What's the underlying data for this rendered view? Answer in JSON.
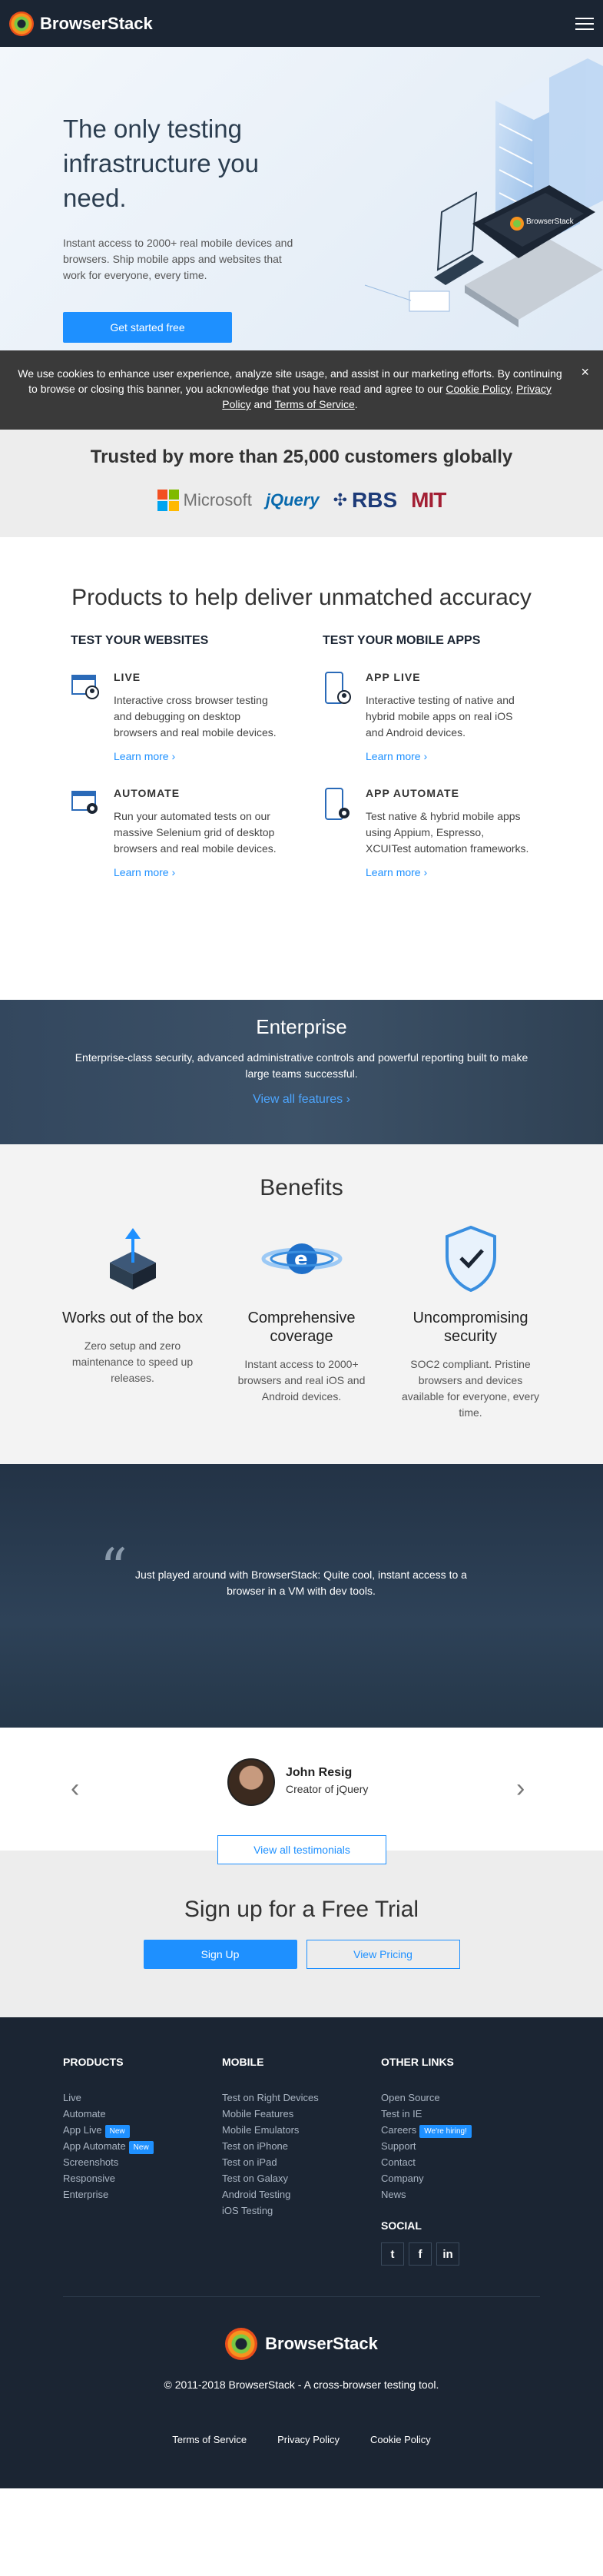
{
  "header": {
    "brand": "BrowserStack"
  },
  "hero": {
    "title": "The only testing infrastructure you need.",
    "subtitle": "Instant access to 2000+ real mobile devices and browsers. Ship mobile apps and websites that work for everyone, every time.",
    "cta": "Get started free"
  },
  "cookie": {
    "text": "We use cookies to enhance user experience, analyze site usage, and assist in our marketing efforts. By continuing to browse or closing this banner, you acknowledge that you have read and agree to our",
    "cookie_policy": "Cookie Policy",
    "comma": ",",
    "privacy_policy": "Privacy Policy",
    "and": "and",
    "terms": "Terms of Service",
    "period": ".",
    "close": "×"
  },
  "trusted": {
    "title": "Trusted by more than 25,000 customers globally",
    "logos": {
      "microsoft": "Microsoft",
      "jquery": "jQuery",
      "rbs": "RBS",
      "mit": "MIT"
    }
  },
  "products": {
    "title": "Products to help deliver unmatched accuracy",
    "websites": {
      "heading": "TEST YOUR WEBSITES",
      "items": [
        {
          "name": "LIVE",
          "desc": "Interactive cross browser testing and debugging on desktop browsers and real mobile devices.",
          "link": "Learn more ›"
        },
        {
          "name": "AUTOMATE",
          "desc": "Run your automated tests on our massive Selenium grid of desktop browsers and real mobile devices.",
          "link": "Learn more ›"
        }
      ]
    },
    "mobile": {
      "heading": "TEST YOUR MOBILE APPS",
      "items": [
        {
          "name": "APP LIVE",
          "desc": "Interactive testing of native and hybrid mobile apps on real iOS and Android devices.",
          "link": "Learn more ›"
        },
        {
          "name": "APP AUTOMATE",
          "desc": "Test native & hybrid mobile apps using Appium, Espresso, XCUITest automation frameworks.",
          "link": "Learn more ›"
        }
      ]
    }
  },
  "enterprise": {
    "title": "Enterprise",
    "desc": "Enterprise-class security, advanced administrative controls and powerful reporting built to make large teams successful.",
    "link": "View all features ›"
  },
  "benefits": {
    "title": "Benefits",
    "items": [
      {
        "title": "Works out of the box",
        "desc": "Zero setup and zero maintenance to speed up releases."
      },
      {
        "title": "Comprehensive coverage",
        "desc": "Instant access to 2000+ browsers and real iOS and Android devices."
      },
      {
        "title": "Uncompromising security",
        "desc": "SOC2 compliant. Pristine browsers and devices available for everyone, every time."
      }
    ]
  },
  "testimonial": {
    "quote_mark": "“",
    "quote": "Just played around with BrowserStack: Quite cool, instant access to a browser in a VM with dev tools.",
    "author": "John Resig",
    "role": "Creator of jQuery",
    "prev": "‹",
    "next": "›",
    "view_all": "View all testimonials"
  },
  "signup": {
    "title": "Sign up for a Free Trial",
    "signup_btn": "Sign Up",
    "pricing_btn": "View Pricing"
  },
  "footer": {
    "products": {
      "heading": "PRODUCTS",
      "links": [
        "Live",
        "Automate",
        "App Live",
        "App Automate",
        "Screenshots",
        "Responsive",
        "Enterprise"
      ],
      "new_badge": "New"
    },
    "mobile": {
      "heading": "MOBILE",
      "links": [
        "Test on Right Devices",
        "Mobile Features",
        "Mobile Emulators",
        "Test on iPhone",
        "Test on iPad",
        "Test on Galaxy",
        "Android Testing",
        "iOS Testing"
      ]
    },
    "other": {
      "heading": "OTHER LINKS",
      "links": [
        "Open Source",
        "Test in IE",
        "Careers",
        "Support",
        "Contact",
        "Company",
        "News"
      ],
      "hiring_badge": "We're hiring!"
    },
    "social": {
      "heading": "SOCIAL",
      "twitter": "t",
      "facebook": "f",
      "linkedin": "in"
    },
    "brand": "BrowserStack",
    "copyright": "© 2011-2018 BrowserStack - A cross-browser testing tool.",
    "legal": {
      "terms": "Terms of Service",
      "privacy": "Privacy Policy",
      "cookie": "Cookie Policy"
    }
  },
  "colors": {
    "navy": "#1b2533",
    "accent": "#1e90ff",
    "banner": "#3a3a3a"
  }
}
